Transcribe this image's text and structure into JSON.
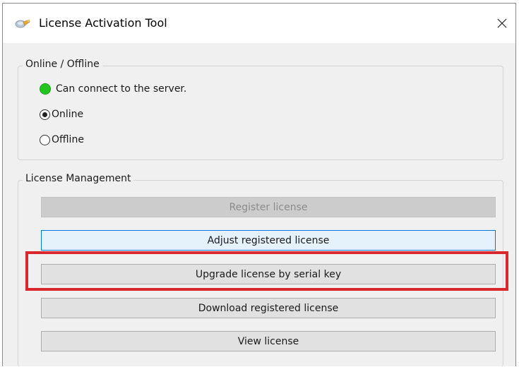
{
  "window": {
    "title": "License Activation Tool",
    "icon": "license-tool-icon",
    "close_icon": "close-icon"
  },
  "online_group": {
    "label": "Online / Offline",
    "status": {
      "text": "Can connect to the server.",
      "color": "#22c51e"
    },
    "options": [
      {
        "label": "Online",
        "selected": true
      },
      {
        "label": "Offline",
        "selected": false
      }
    ]
  },
  "license_group": {
    "label": "License Management",
    "buttons": [
      {
        "label": "Register license",
        "state": "disabled"
      },
      {
        "label": "Adjust registered license",
        "state": "focused"
      },
      {
        "label": "Upgrade license by serial key",
        "state": "normal"
      },
      {
        "label": "Download registered license",
        "state": "normal"
      },
      {
        "label": "View license",
        "state": "normal"
      }
    ]
  },
  "annotation": {
    "highlight_color": "#d9272e",
    "highlighted_button": "Upgrade license by serial key"
  }
}
